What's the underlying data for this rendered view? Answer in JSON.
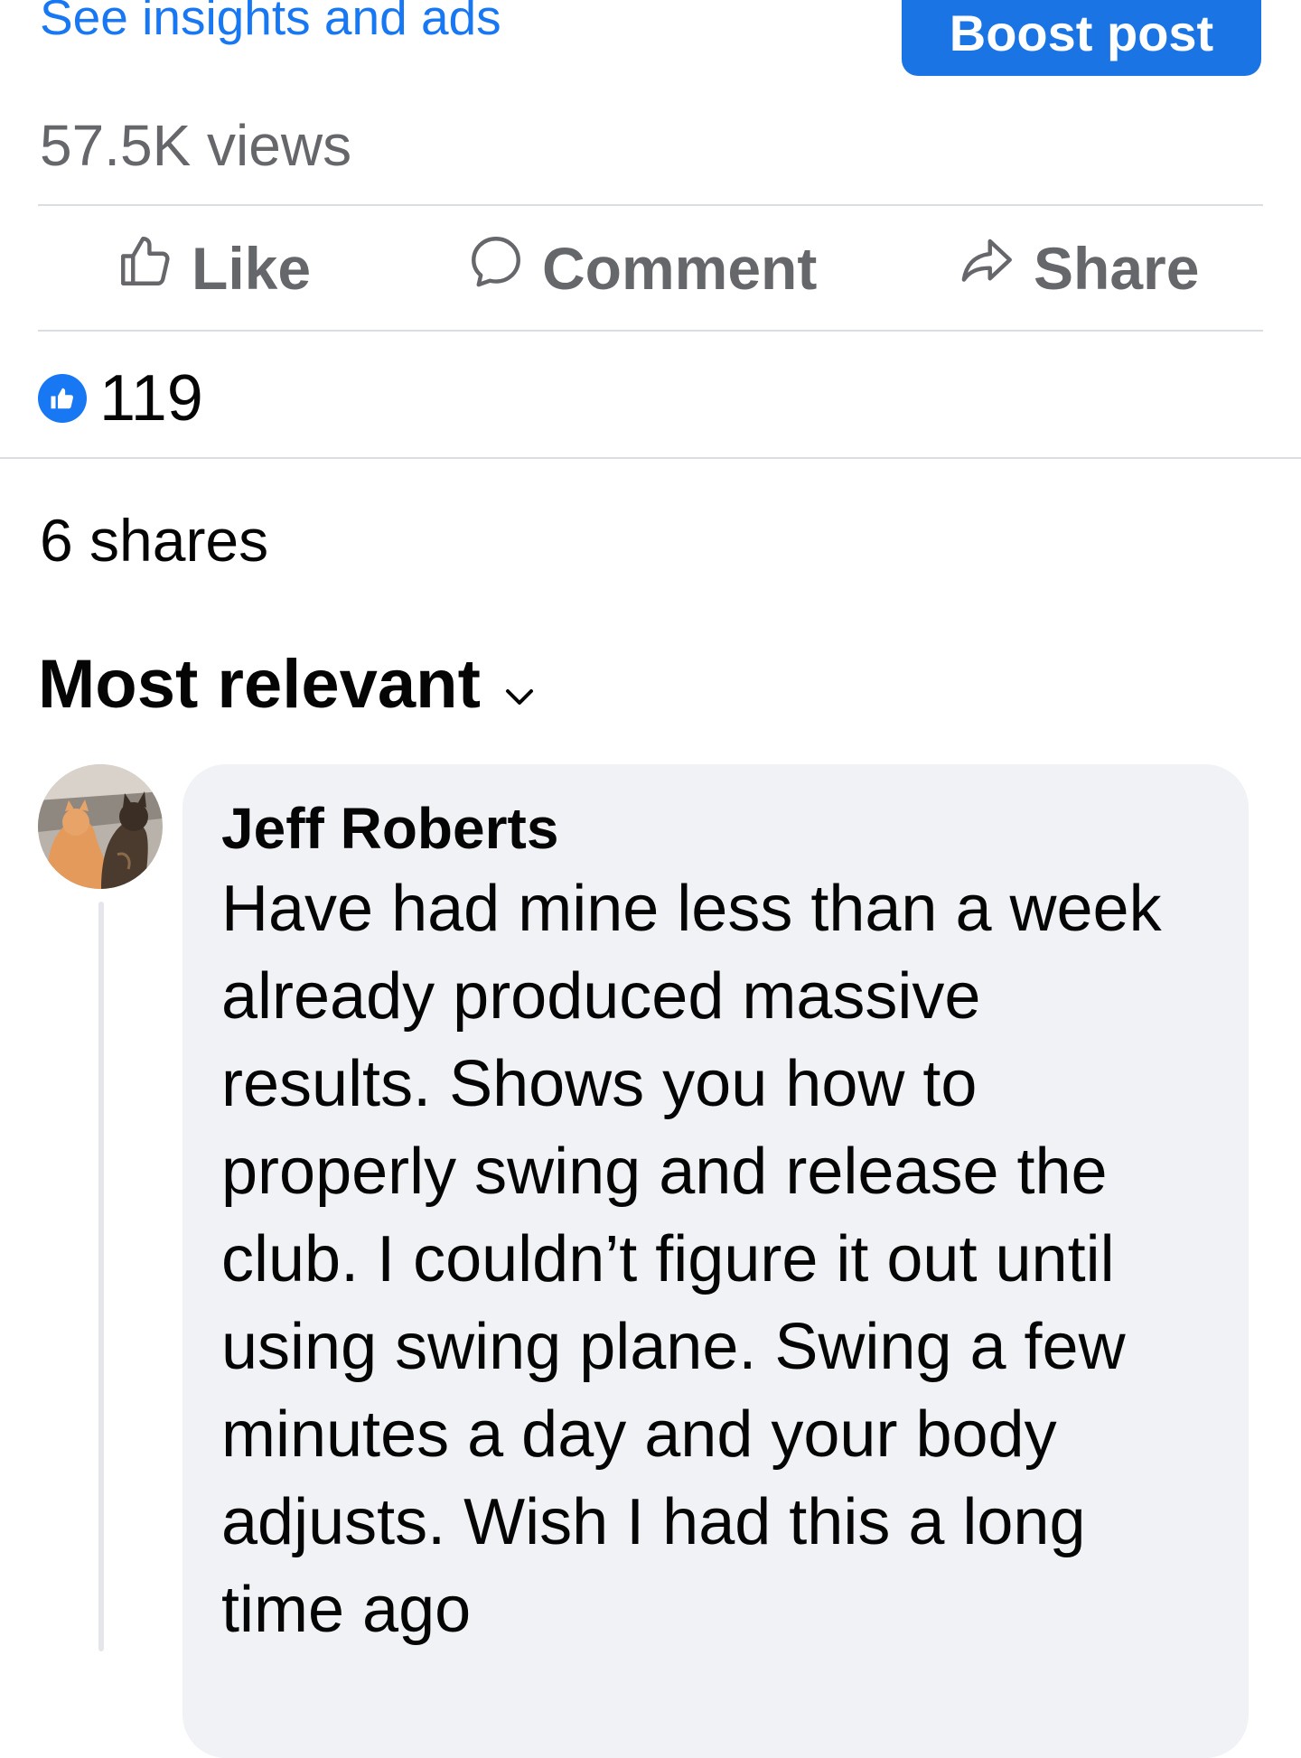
{
  "post_footer": {
    "insights_link": "See insights and ads",
    "boost_button": "Boost post",
    "views": "57.5K views"
  },
  "actions": {
    "like": "Like",
    "comment": "Comment",
    "share": "Share"
  },
  "stats": {
    "reaction_count": "119",
    "shares": "6 shares"
  },
  "comments_sort": {
    "label": "Most relevant"
  },
  "comment": {
    "author": "Jeff Roberts",
    "text": "Have had mine less than a week\nalready produced massive\nresults. Shows you how to\nproperly swing and release the\nclub. I couldn’t figure it out until\nusing swing plane. Swing a few\nminutes a day and your body\nadjusts. Wish I had this a long\ntime ago"
  },
  "colors": {
    "accent": "#1877f2",
    "secondary_text": "#65676b",
    "bubble": "#f0f2f5"
  },
  "icons": [
    "thumbs-up-icon",
    "comment-bubble-icon",
    "share-arrow-icon",
    "like-reaction-icon",
    "chevron-down-icon"
  ]
}
